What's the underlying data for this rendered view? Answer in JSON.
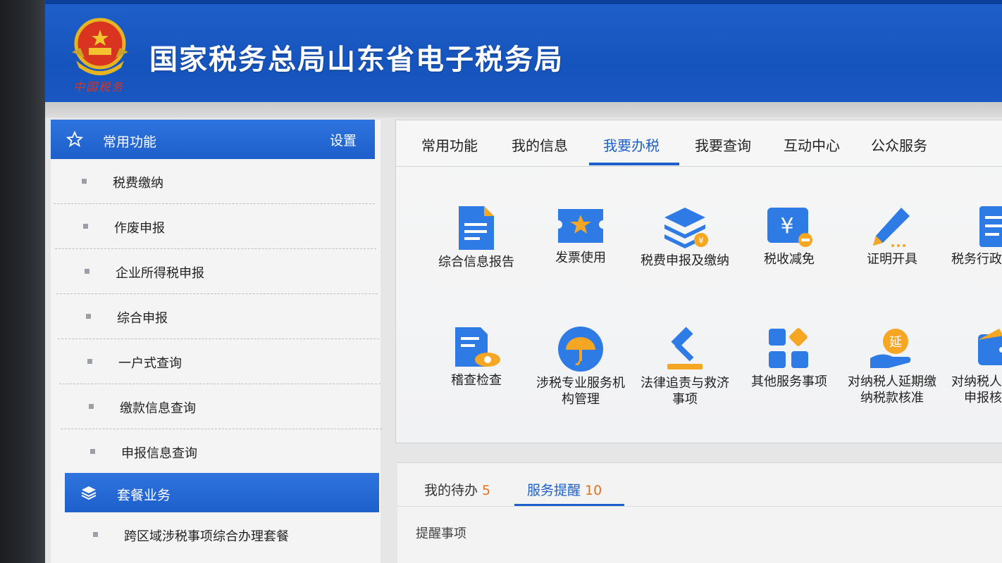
{
  "header": {
    "title": "国家税务总局山东省电子税务局",
    "emblem_caption": "中国税务",
    "brand_color": "#1654bd"
  },
  "sidebar": {
    "common": {
      "title": "常用功能",
      "settings_label": "设置",
      "items": [
        "税费缴纳",
        "作废申报",
        "企业所得税申报",
        "综合申报",
        "一户式查询",
        "缴款信息查询",
        "申报信息查询"
      ]
    },
    "package": {
      "title": "套餐业务",
      "items": [
        "跨区域涉税事项综合办理套餐"
      ]
    }
  },
  "tabs": {
    "items": [
      "常用功能",
      "我的信息",
      "我要办税",
      "我要查询",
      "互动中心",
      "公众服务"
    ],
    "active": "我要办税"
  },
  "tiles": {
    "row1": [
      {
        "label": "综合信息报告",
        "icon": "document-icon"
      },
      {
        "label": "发票使用",
        "icon": "invoice-ticket-icon"
      },
      {
        "label": "税费申报及缴纳",
        "icon": "layers-yuan-icon"
      },
      {
        "label": "税收减免",
        "icon": "yuan-minus-icon"
      },
      {
        "label": "证明开具",
        "icon": "pen-icon"
      },
      {
        "label": "税务行政许可",
        "icon": "document-list-icon"
      }
    ],
    "row2": [
      {
        "label": "稽查检查",
        "icon": "inspect-eye-icon"
      },
      {
        "label": "涉税专业服务机构管理",
        "icon": "umbrella-icon"
      },
      {
        "label": "法律追责与救济事项",
        "icon": "gavel-icon"
      },
      {
        "label": "其他服务事项",
        "icon": "grid-diamond-icon"
      },
      {
        "label": "对纳税人延期缴纳税款核准",
        "icon": "hand-extend-icon"
      },
      {
        "label": "对纳税人延期申报核准",
        "icon": "wallet-icon"
      }
    ]
  },
  "lower": {
    "tabs": [
      {
        "label": "我的待办",
        "count": "5"
      },
      {
        "label": "服务提醒",
        "count": "10"
      }
    ],
    "active": "服务提醒",
    "reminder_label": "提醒事项"
  }
}
